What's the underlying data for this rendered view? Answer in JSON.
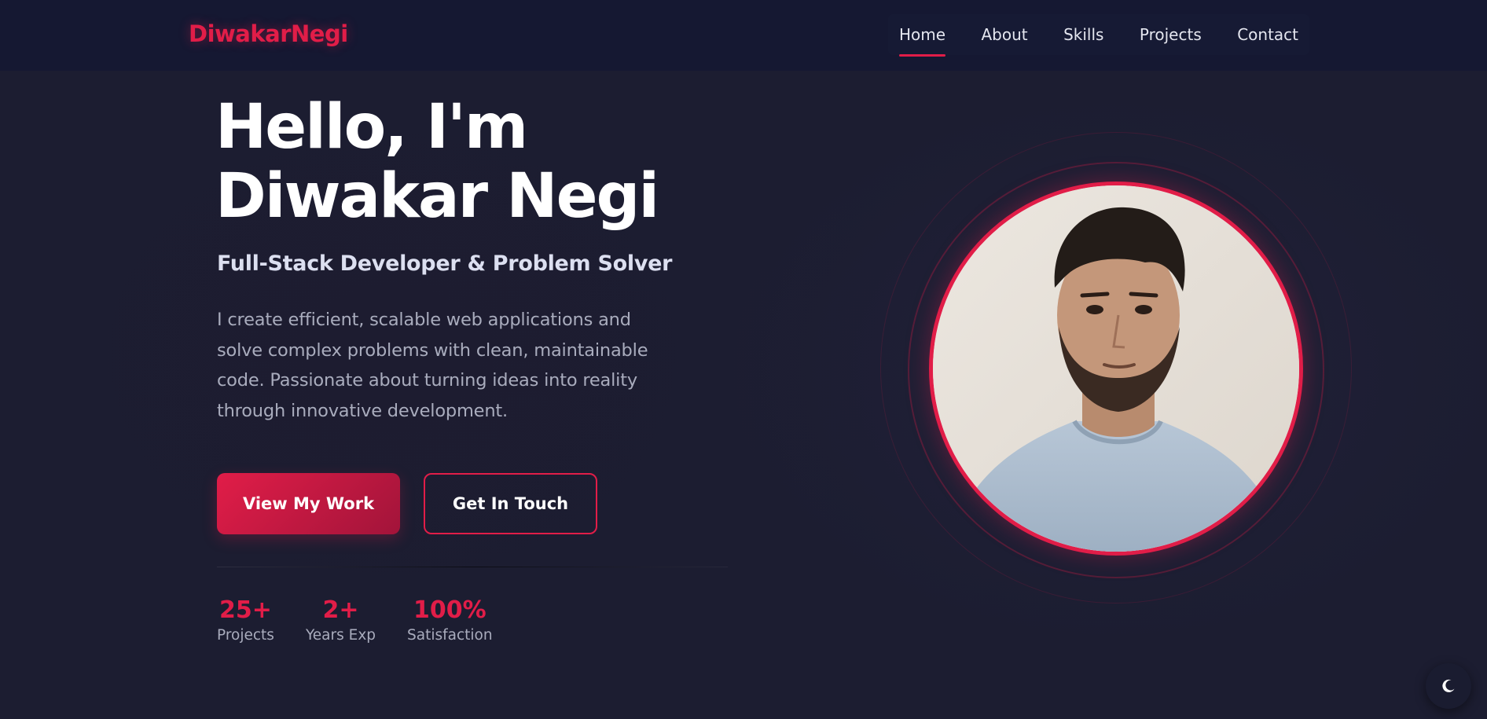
{
  "brand": {
    "logo_text": "DiwakarNegi",
    "accent_color": "#e11d48"
  },
  "nav": {
    "items": [
      {
        "label": "Home",
        "active": true
      },
      {
        "label": "About",
        "active": false
      },
      {
        "label": "Skills",
        "active": false
      },
      {
        "label": "Projects",
        "active": false
      },
      {
        "label": "Contact",
        "active": false
      }
    ]
  },
  "hero": {
    "title_line1": "Hello, I'm",
    "title_line2": "Diwakar Negi",
    "subtitle": "Full-Stack Developer & Problem Solver",
    "description": "I create efficient, scalable web applications and solve complex problems with clean, maintainable code. Passionate about turning ideas into reality through innovative development.",
    "primary_button": "View My Work",
    "secondary_button": "Get In Touch"
  },
  "stats": [
    {
      "value": "25+",
      "label": "Projects"
    },
    {
      "value": "2+",
      "label": "Years Exp"
    },
    {
      "value": "100%",
      "label": "Satisfaction"
    }
  ],
  "profile": {
    "image_icon": "profile-photo"
  },
  "theme_toggle": {
    "icon": "moon-icon"
  }
}
